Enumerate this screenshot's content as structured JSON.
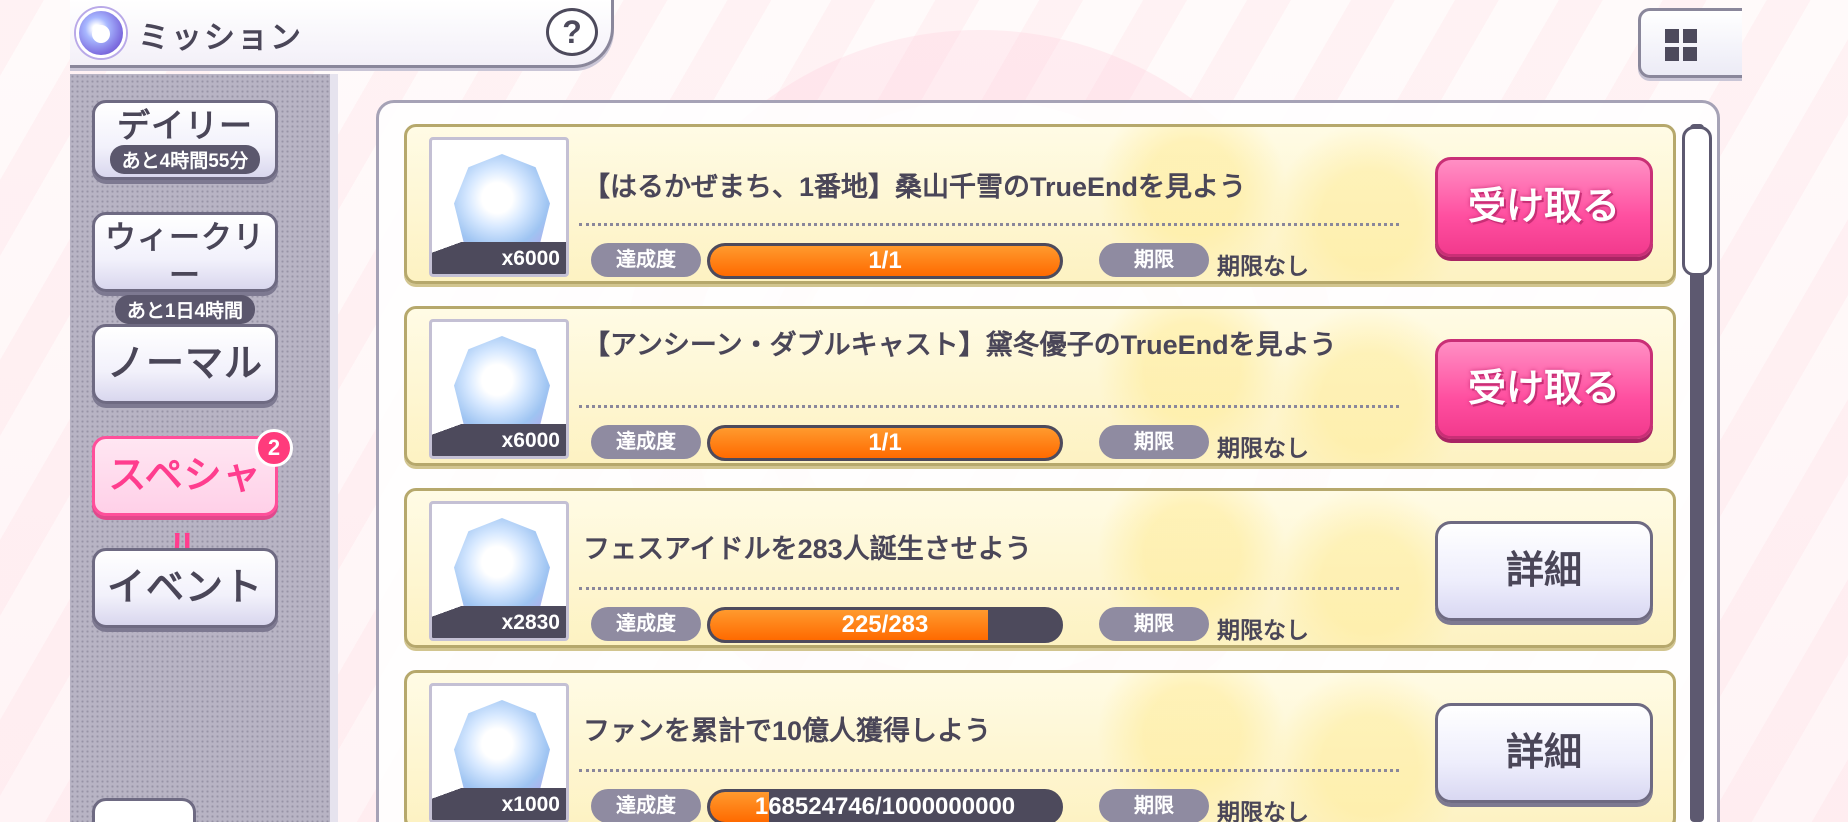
{
  "header": {
    "title": "ミッション",
    "help_label": "?"
  },
  "sidebar": {
    "tabs": [
      {
        "label": "デイリー",
        "sub": "あと4時間55分",
        "active": false
      },
      {
        "label": "ウィークリー",
        "sub": "あと1日4時間",
        "active": false
      },
      {
        "label": "ノーマル",
        "sub": "",
        "active": false
      },
      {
        "label": "スペシャル",
        "sub": "",
        "active": true,
        "badge": "2"
      },
      {
        "label": "イベント",
        "sub": "",
        "active": false
      }
    ]
  },
  "labels": {
    "progress": "達成度",
    "deadline": "期限"
  },
  "missions": [
    {
      "title": "【はるかぜまち、1番地】桑山千雪のTrueEndを見よう",
      "reward_qty": "x6000",
      "progress_text": "1/1",
      "progress_fraction": 1.0,
      "deadline": "期限なし",
      "action": "受け取る",
      "action_type": "claim"
    },
    {
      "title": "【アンシーン・ダブルキャスト】黛冬優子のTrueEndを見よう",
      "reward_qty": "x6000",
      "progress_text": "1/1",
      "progress_fraction": 1.0,
      "deadline": "期限なし",
      "action": "受け取る",
      "action_type": "claim"
    },
    {
      "title": "フェスアイドルを283人誕生させよう",
      "reward_qty": "x2830",
      "progress_text": "225/283",
      "progress_fraction": 0.795,
      "deadline": "期限なし",
      "action": "詳細",
      "action_type": "detail"
    },
    {
      "title": "ファンを累計で10億人獲得しよう",
      "reward_qty": "x1000",
      "progress_text": "168524746/1000000000",
      "progress_fraction": 0.1685,
      "deadline": "期限なし",
      "action": "詳細",
      "action_type": "detail"
    }
  ],
  "colors": {
    "claim_pink": "#ff4fa0",
    "progress_orange": "#ff6a00",
    "active_tab_pink": "#ff3d8e"
  }
}
